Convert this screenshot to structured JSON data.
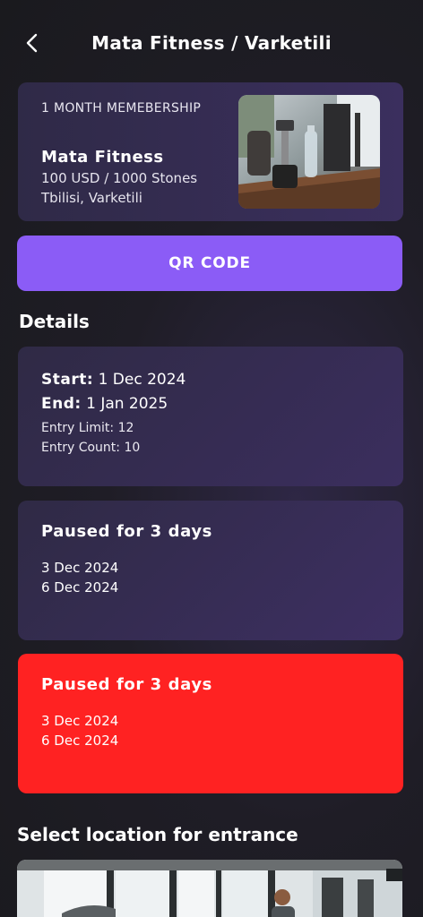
{
  "header": {
    "title": "Mata Fitness / Varketili",
    "back_icon": "chevron-left-icon"
  },
  "membership": {
    "type": "1 MONTH MEMEBERSHIP",
    "gym_name": "Mata Fitness",
    "price": "100 USD / 1000 Stones",
    "location": "Tbilisi, Varketili",
    "image": "gym-equipment-image"
  },
  "qr_button": {
    "label": "QR CODE"
  },
  "details": {
    "section_title": "Details",
    "start_label": "Start:",
    "start_value": "1 Dec 2024",
    "end_label": "End:",
    "end_value": "1 Jan 2025",
    "entry_limit": "Entry Limit: 12",
    "entry_count": "Entry Count: 10"
  },
  "pauses": [
    {
      "title": "Paused for 3 days",
      "from": "3 Dec 2024",
      "to": "6 Dec 2024",
      "color": "#3a2e5a"
    },
    {
      "title": "Paused for 3 days",
      "from": "3 Dec 2024",
      "to": "6 Dec 2024",
      "color": "#ff2222"
    }
  ],
  "locations": {
    "section_title": "Select location for entrance",
    "image": "gym-interior-image"
  },
  "colors": {
    "accent": "#8b5cf6",
    "danger": "#ff2222",
    "background": "#1c1b21"
  }
}
